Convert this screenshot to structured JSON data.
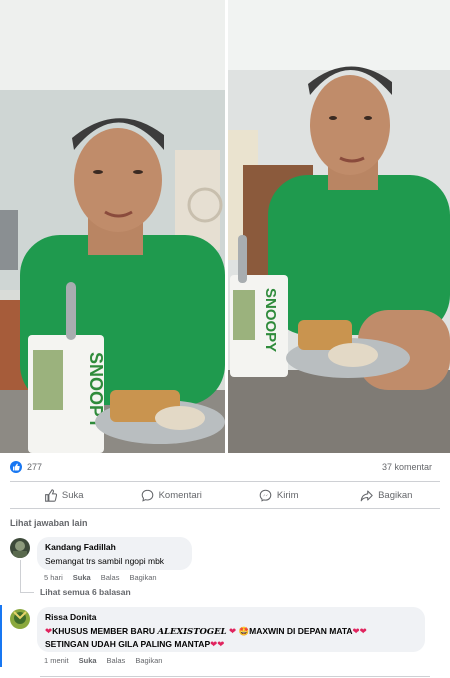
{
  "post": {
    "photos": [
      "photo-left",
      "photo-right"
    ],
    "photo_text": "SNOOPY"
  },
  "stats": {
    "likes": "277",
    "comments": "37 komentar",
    "reaction_icon": "thumbs-up-icon",
    "reaction_color": "#1877f2"
  },
  "actions": {
    "like": "Suka",
    "comment": "Komentari",
    "send": "Kirim",
    "share": "Bagikan"
  },
  "comments_section": {
    "more_replies": "Lihat jawaban lain",
    "comments": [
      {
        "author": "Kandang Fadillah",
        "text": "Semangat trs sambil ngopi mbk",
        "time": "5 hari",
        "like": "Suka",
        "reply": "Balas",
        "share": "Bagikan",
        "view_replies": "Lihat semua 6 balasan"
      },
      {
        "author": "Rissa Donita",
        "text_line1_a": "KHUSUS MEMBER BARU ",
        "text_line1_brand": "ALEXISTOGEL",
        "text_line1_b": "MAXWIN DI DEPAN MATA",
        "text_line2": "SETINGAN UDAH GILA PALING MANTAP",
        "time": "1 menit",
        "like": "Suka",
        "reply": "Balas",
        "share": "Bagikan"
      }
    ]
  }
}
